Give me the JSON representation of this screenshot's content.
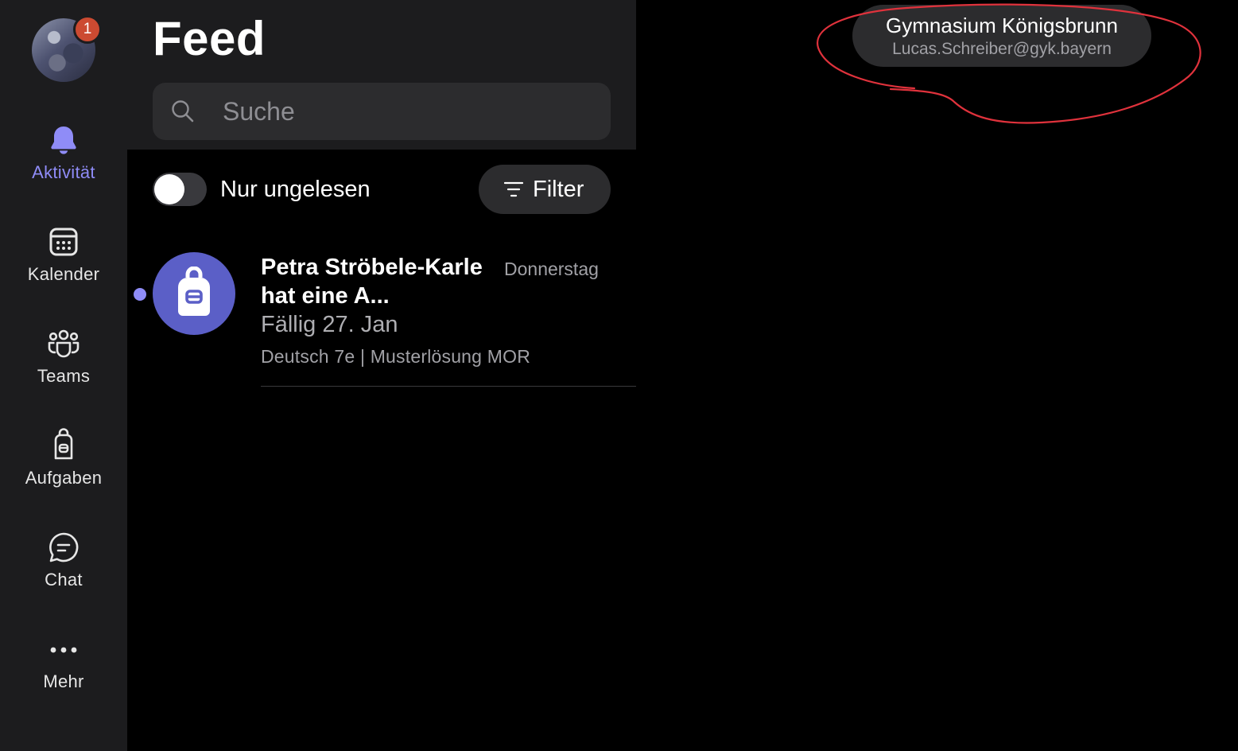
{
  "rail": {
    "badge_count": "1",
    "items": [
      {
        "label": "Aktivität",
        "icon": "bell-icon",
        "active": true
      },
      {
        "label": "Kalender",
        "icon": "calendar-icon",
        "active": false
      },
      {
        "label": "Teams",
        "icon": "teams-icon",
        "active": false
      },
      {
        "label": "Aufgaben",
        "icon": "backpack-icon",
        "active": false
      },
      {
        "label": "Chat",
        "icon": "chat-bubble-icon",
        "active": false
      },
      {
        "label": "Mehr",
        "icon": "more-dots-icon",
        "active": false
      }
    ]
  },
  "feed": {
    "title": "Feed",
    "search": {
      "placeholder": "Suche",
      "value": ""
    },
    "unread_toggle": {
      "label": "Nur ungelesen",
      "on": false
    },
    "filter_label": "Filter",
    "items": [
      {
        "title": "Petra Ströbele-Karle hat eine A...",
        "date": "Donnerstag",
        "due": "Fällig 27. Jan",
        "meta": "Deutsch 7e | Musterlösung MOR",
        "icon": "backpack-icon",
        "unread": true
      }
    ]
  },
  "account": {
    "organization": "Gymnasium Königsbrunn",
    "email": "Lucas.Schreiber@gyk.bayern"
  },
  "colors": {
    "accent": "#8f8cf7",
    "assignment_icon_bg": "#5b5fc7",
    "badge": "#cc4a31",
    "annotation": "#e0323c",
    "panel": "#1c1c1e",
    "control": "#2c2c2e"
  }
}
